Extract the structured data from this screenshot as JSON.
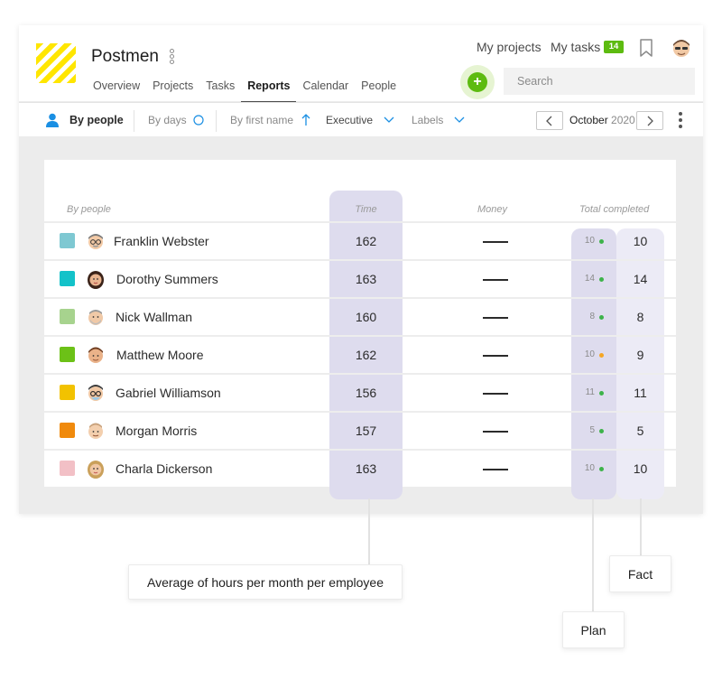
{
  "header": {
    "project_name": "Postmen",
    "tabs": [
      {
        "label": "Overview"
      },
      {
        "label": "Projects"
      },
      {
        "label": "Tasks"
      },
      {
        "label": "Reports",
        "active": true
      },
      {
        "label": "Calendar"
      },
      {
        "label": "People"
      }
    ],
    "my_projects": "My projects",
    "my_tasks": "My tasks",
    "tasks_count": "14",
    "add_label": "+",
    "search_placeholder": "Search"
  },
  "toolbar": {
    "by_people": "By people",
    "by_days": "By days",
    "by_first_name": "By first name",
    "executive": "Executive",
    "labels": "Labels",
    "month": "October",
    "year": "2020"
  },
  "table": {
    "columns": {
      "people": "By people",
      "time": "Time",
      "money": "Money",
      "total_completed": "Total completed"
    },
    "rows": [
      {
        "name": "Franklin Webster",
        "color": "#7ec8d2",
        "time": "162",
        "plan": "10",
        "plan_status": "#3db34a",
        "fact": "10"
      },
      {
        "name": "Dorothy Summers",
        "color": "#13c2c9",
        "time": "163",
        "plan": "14",
        "plan_status": "#3db34a",
        "fact": "14"
      },
      {
        "name": "Nick Wallman",
        "color": "#a7d38e",
        "time": "160",
        "plan": "8",
        "plan_status": "#3db34a",
        "fact": "8"
      },
      {
        "name": "Matthew Moore",
        "color": "#6cc117",
        "time": "162",
        "plan": "10",
        "plan_status": "#f5a623",
        "fact": "9"
      },
      {
        "name": "Gabriel Williamson",
        "color": "#f2c200",
        "time": "156",
        "plan": "11",
        "plan_status": "#3db34a",
        "fact": "11"
      },
      {
        "name": "Morgan Morris",
        "color": "#f08a0c",
        "time": "157",
        "plan": "5",
        "plan_status": "#3db34a",
        "fact": "5"
      },
      {
        "name": "Charla Dickerson",
        "color": "#f2c0c6",
        "time": "163",
        "plan": "10",
        "plan_status": "#3db34a",
        "fact": "10"
      }
    ]
  },
  "callouts": {
    "average": "Average of hours per month per employee",
    "plan": "Plan",
    "fact": "Fact"
  },
  "colors": {
    "accent_green": "#5dbb10",
    "accent_blue": "#1a8fe3",
    "highlight": "#dedcee"
  }
}
